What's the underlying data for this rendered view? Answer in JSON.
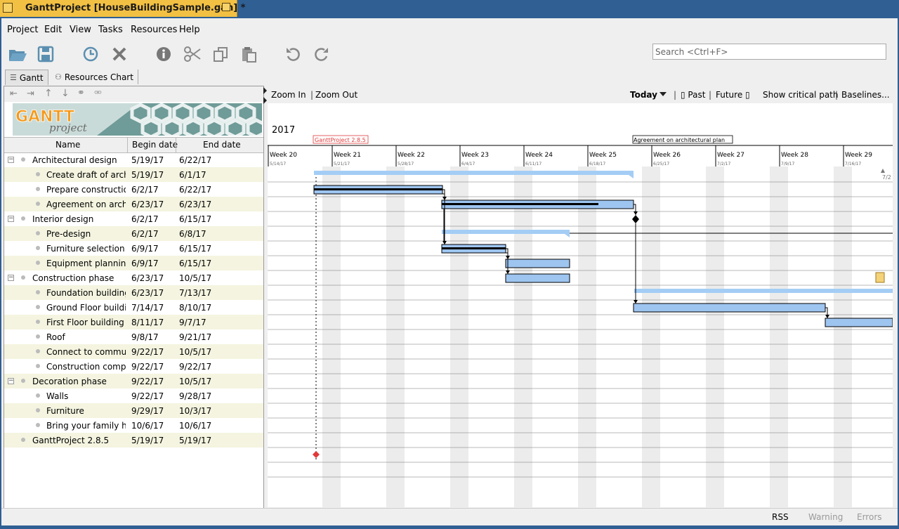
{
  "window": {
    "title": "GanttProject [HouseBuildingSample.gan] *"
  },
  "menu": [
    "Project",
    "Edit",
    "View",
    "Tasks",
    "Resources",
    "Help"
  ],
  "toolbar": {
    "search_placeholder": "Search <Ctrl+F>"
  },
  "tabs": [
    {
      "label": "Gantt"
    },
    {
      "label": "Resources Chart"
    }
  ],
  "table": {
    "headers": {
      "name": "Name",
      "begin": "Begin date",
      "end": "End date"
    },
    "rows": [
      {
        "name": "Architectural design",
        "begin": "5/19/17",
        "end": "6/22/17",
        "level": 0,
        "group": true
      },
      {
        "name": "Create draft of arch...",
        "begin": "5/19/17",
        "end": "6/1/17",
        "level": 1,
        "group": false
      },
      {
        "name": "Prepare constructio...",
        "begin": "6/2/17",
        "end": "6/22/17",
        "level": 1,
        "group": false
      },
      {
        "name": "Agreement on archi...",
        "begin": "6/23/17",
        "end": "6/23/17",
        "level": 1,
        "group": false
      },
      {
        "name": "Interior design",
        "begin": "6/2/17",
        "end": "6/15/17",
        "level": 0,
        "group": true
      },
      {
        "name": "Pre-design",
        "begin": "6/2/17",
        "end": "6/8/17",
        "level": 1,
        "group": false
      },
      {
        "name": "Furniture selection",
        "begin": "6/9/17",
        "end": "6/15/17",
        "level": 1,
        "group": false
      },
      {
        "name": "Equipment planning",
        "begin": "6/9/17",
        "end": "6/15/17",
        "level": 1,
        "group": false
      },
      {
        "name": "Construction phase",
        "begin": "6/23/17",
        "end": "10/5/17",
        "level": 0,
        "group": true
      },
      {
        "name": "Foundation building",
        "begin": "6/23/17",
        "end": "7/13/17",
        "level": 1,
        "group": false
      },
      {
        "name": "Ground Floor buildi...",
        "begin": "7/14/17",
        "end": "8/10/17",
        "level": 1,
        "group": false
      },
      {
        "name": "First Floor building",
        "begin": "8/11/17",
        "end": "9/7/17",
        "level": 1,
        "group": false
      },
      {
        "name": "Roof",
        "begin": "9/8/17",
        "end": "9/21/17",
        "level": 1,
        "group": false
      },
      {
        "name": "Connect to commu...",
        "begin": "9/22/17",
        "end": "10/5/17",
        "level": 1,
        "group": false
      },
      {
        "name": "Construction compl...",
        "begin": "9/22/17",
        "end": "9/22/17",
        "level": 1,
        "group": false
      },
      {
        "name": "Decoration phase",
        "begin": "9/22/17",
        "end": "10/5/17",
        "level": 0,
        "group": true
      },
      {
        "name": "Walls",
        "begin": "9/22/17",
        "end": "9/28/17",
        "level": 1,
        "group": false
      },
      {
        "name": "Furniture",
        "begin": "9/29/17",
        "end": "10/3/17",
        "level": 1,
        "group": false
      },
      {
        "name": "Bring your family h...",
        "begin": "10/6/17",
        "end": "10/6/17",
        "level": 1,
        "group": false
      },
      {
        "name": "GanttProject 2.8.5",
        "begin": "5/19/17",
        "end": "5/19/17",
        "level": 0,
        "group": false
      }
    ]
  },
  "chart": {
    "zoom_in": "Zoom In",
    "zoom_out": "Zoom Out",
    "today": "Today",
    "past": "Past",
    "future": "Future",
    "critical_path": "Show critical path",
    "baselines": "Baselines...",
    "year": "2017",
    "milestone_label": "GanttProject 2.8.5",
    "agreement_label": "Agreement on architectural plan",
    "weeks": [
      {
        "label": "Week 20",
        "date": "5/14/17"
      },
      {
        "label": "Week 21",
        "date": "5/21/17"
      },
      {
        "label": "Week 22",
        "date": "5/28/17"
      },
      {
        "label": "Week 23",
        "date": "6/4/17"
      },
      {
        "label": "Week 24",
        "date": "6/11/17"
      },
      {
        "label": "Week 25",
        "date": "6/18/17"
      },
      {
        "label": "Week 26",
        "date": "6/25/17"
      },
      {
        "label": "Week 27",
        "date": "7/2/17"
      },
      {
        "label": "Week 28",
        "date": "7/9/17"
      },
      {
        "label": "Week 29",
        "date": "7/16/17"
      }
    ],
    "edge_label": "7/2",
    "colors": {
      "bar": "#9ec5f0",
      "summary": "#a4cdf5",
      "milestone": "#e03a3a",
      "weekend": "#ececec"
    }
  },
  "status": {
    "rss": "RSS",
    "warning": "Warning",
    "errors": "Errors"
  }
}
